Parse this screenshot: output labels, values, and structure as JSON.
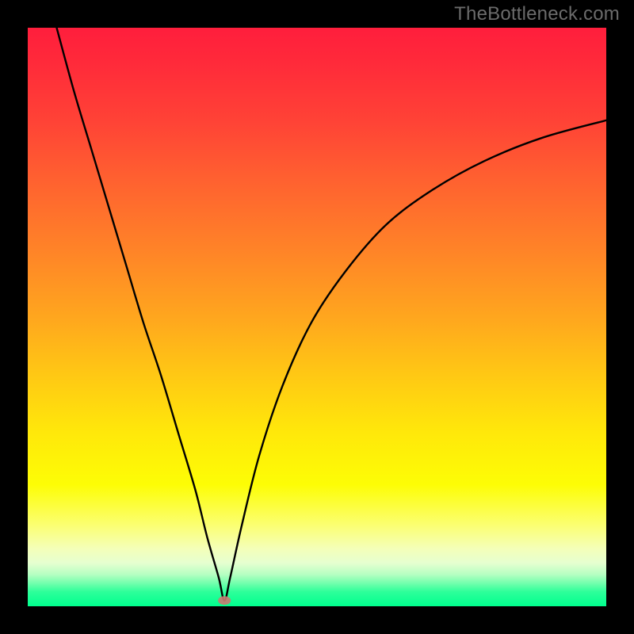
{
  "branding": {
    "label": "TheBottleneck.com"
  },
  "chart_data": {
    "type": "line",
    "title": "",
    "xlabel": "",
    "ylabel": "",
    "xlim": [
      0,
      100
    ],
    "ylim": [
      0,
      100
    ],
    "grid": false,
    "legend": false,
    "background_gradient_stops": [
      {
        "pos": 0,
        "color": "#ff1e3c"
      },
      {
        "pos": 50,
        "color": "#ffa61e"
      },
      {
        "pos": 79,
        "color": "#fdfd05"
      },
      {
        "pos": 96,
        "color": "#73ffad"
      },
      {
        "pos": 100,
        "color": "#00ff8e"
      }
    ],
    "minimum_point": {
      "x": 34,
      "y": 1
    },
    "series": [
      {
        "name": "left-branch",
        "x": [
          5,
          8,
          11,
          14,
          17,
          20,
          23,
          26,
          29,
          31,
          33,
          34
        ],
        "y": [
          100,
          89,
          79,
          69,
          59,
          49,
          40,
          30,
          20,
          12,
          5,
          1
        ]
      },
      {
        "name": "right-branch",
        "x": [
          34,
          35,
          37,
          40,
          44,
          49,
          55,
          62,
          70,
          79,
          89,
          100
        ],
        "y": [
          1,
          5,
          14,
          26,
          38,
          49,
          58,
          66,
          72,
          77,
          81,
          84
        ]
      }
    ]
  }
}
